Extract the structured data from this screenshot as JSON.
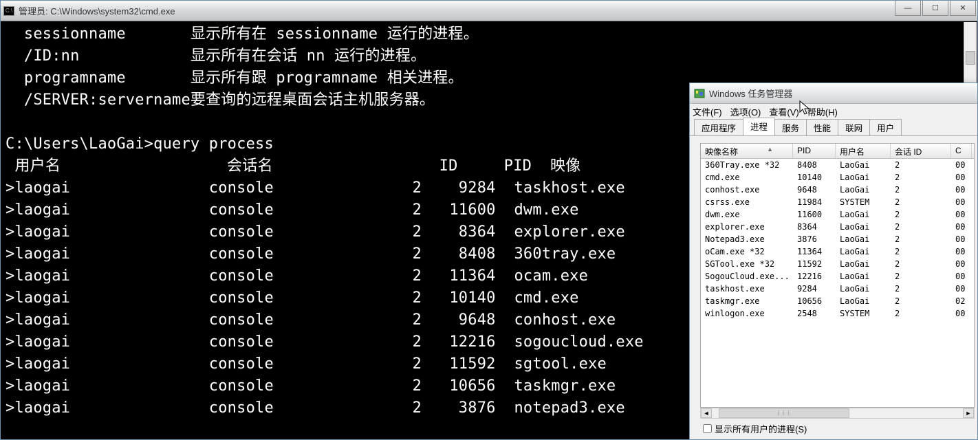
{
  "cmd": {
    "title": "管理员: C:\\Windows\\system32\\cmd.exe",
    "help_lines": [
      {
        "flag": "  sessionname",
        "desc": "显示所有在 sessionname 运行的进程。"
      },
      {
        "flag": "  /ID:nn",
        "desc": "显示所有在会话 nn 运行的进程。"
      },
      {
        "flag": "  programname",
        "desc": "显示所有跟 programname 相关进程。"
      },
      {
        "flag": "  /SERVER:servername",
        "desc": "要查询的远程桌面会话主机服务器。"
      }
    ],
    "prompt": "C:\\Users\\LaoGai>",
    "command": "query process",
    "header": {
      "user": " 用户名",
      "session": "会话名",
      "id": "ID",
      "pid": "PID",
      "image": "映像"
    },
    "rows": [
      {
        "user": ">laogai",
        "session": "console",
        "id": "2",
        "pid": "9284",
        "image": "taskhost.exe"
      },
      {
        "user": ">laogai",
        "session": "console",
        "id": "2",
        "pid": "11600",
        "image": "dwm.exe"
      },
      {
        "user": ">laogai",
        "session": "console",
        "id": "2",
        "pid": "8364",
        "image": "explorer.exe"
      },
      {
        "user": ">laogai",
        "session": "console",
        "id": "2",
        "pid": "8408",
        "image": "360tray.exe"
      },
      {
        "user": ">laogai",
        "session": "console",
        "id": "2",
        "pid": "11364",
        "image": "ocam.exe"
      },
      {
        "user": ">laogai",
        "session": "console",
        "id": "2",
        "pid": "10140",
        "image": "cmd.exe"
      },
      {
        "user": ">laogai",
        "session": "console",
        "id": "2",
        "pid": "9648",
        "image": "conhost.exe"
      },
      {
        "user": ">laogai",
        "session": "console",
        "id": "2",
        "pid": "12216",
        "image": "sogoucloud.exe"
      },
      {
        "user": ">laogai",
        "session": "console",
        "id": "2",
        "pid": "11592",
        "image": "sgtool.exe"
      },
      {
        "user": ">laogai",
        "session": "console",
        "id": "2",
        "pid": "10656",
        "image": "taskmgr.exe"
      },
      {
        "user": ">laogai",
        "session": "console",
        "id": "2",
        "pid": "3876",
        "image": "notepad3.exe"
      }
    ]
  },
  "tm": {
    "title": "Windows 任务管理器",
    "menu": {
      "file": "文件(F)",
      "options": "选项(O)",
      "view": "查看(V)",
      "help": "帮助(H)"
    },
    "tabs": {
      "apps": "应用程序",
      "processes": "进程",
      "services": "服务",
      "performance": "性能",
      "network": "联网",
      "users": "用户"
    },
    "columns": {
      "name": "映像名称",
      "pid": "PID",
      "user": "用户名",
      "session": "会话 ID",
      "cpu": "C"
    },
    "rows": [
      {
        "name": "360Tray.exe *32",
        "pid": "8408",
        "user": "LaoGai",
        "session": "2",
        "cpu": "00"
      },
      {
        "name": "cmd.exe",
        "pid": "10140",
        "user": "LaoGai",
        "session": "2",
        "cpu": "00"
      },
      {
        "name": "conhost.exe",
        "pid": "9648",
        "user": "LaoGai",
        "session": "2",
        "cpu": "00"
      },
      {
        "name": "csrss.exe",
        "pid": "11984",
        "user": "SYSTEM",
        "session": "2",
        "cpu": "00"
      },
      {
        "name": "dwm.exe",
        "pid": "11600",
        "user": "LaoGai",
        "session": "2",
        "cpu": "00"
      },
      {
        "name": "explorer.exe",
        "pid": "8364",
        "user": "LaoGai",
        "session": "2",
        "cpu": "00"
      },
      {
        "name": "Notepad3.exe",
        "pid": "3876",
        "user": "LaoGai",
        "session": "2",
        "cpu": "00"
      },
      {
        "name": "oCam.exe *32",
        "pid": "11364",
        "user": "LaoGai",
        "session": "2",
        "cpu": "00"
      },
      {
        "name": "SGTool.exe *32",
        "pid": "11592",
        "user": "LaoGai",
        "session": "2",
        "cpu": "00"
      },
      {
        "name": "SogouCloud.exe...",
        "pid": "12216",
        "user": "LaoGai",
        "session": "2",
        "cpu": "00"
      },
      {
        "name": "taskhost.exe",
        "pid": "9284",
        "user": "LaoGai",
        "session": "2",
        "cpu": "00"
      },
      {
        "name": "taskmgr.exe",
        "pid": "10656",
        "user": "LaoGai",
        "session": "2",
        "cpu": "02"
      },
      {
        "name": "winlogon.exe",
        "pid": "2548",
        "user": "SYSTEM",
        "session": "2",
        "cpu": "00"
      }
    ],
    "checkbox_label": "显示所有用户的进程(S)"
  }
}
